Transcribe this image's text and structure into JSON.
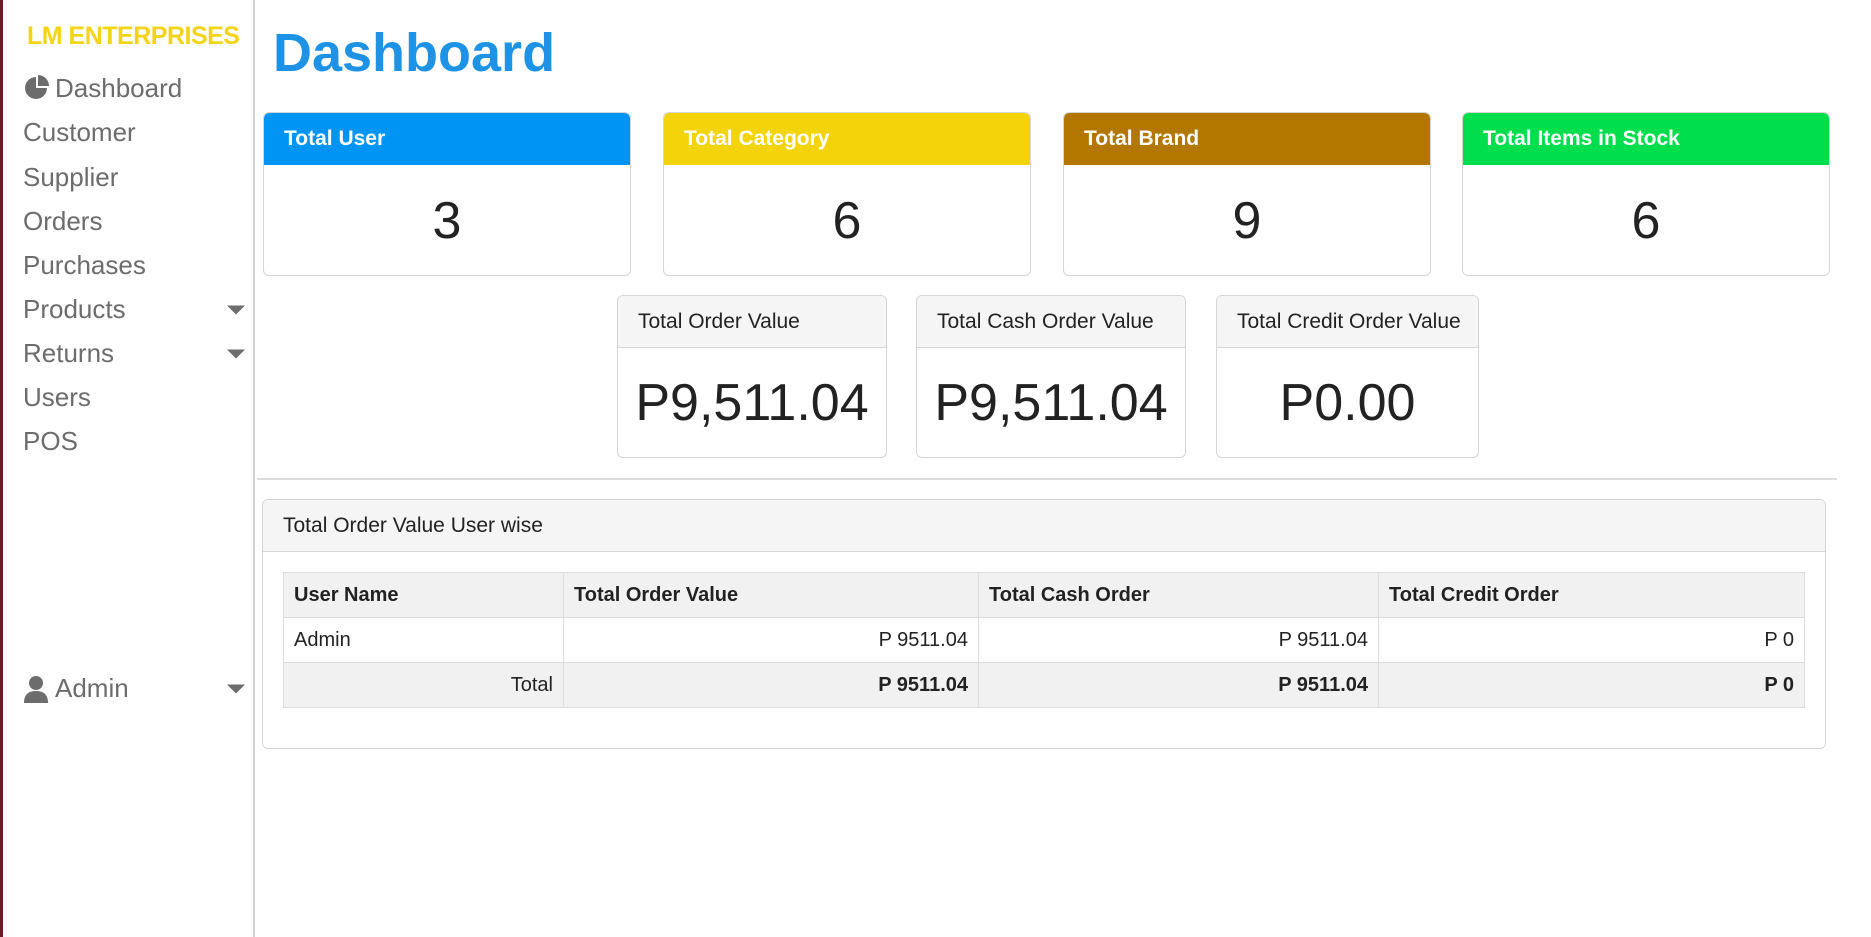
{
  "sidebar": {
    "brand": "LM ENTERPRISES",
    "items": [
      {
        "label": "Dashboard",
        "icon": "pie-chart-icon"
      },
      {
        "label": "Customer"
      },
      {
        "label": "Supplier"
      },
      {
        "label": "Orders"
      },
      {
        "label": "Purchases"
      },
      {
        "label": "Products",
        "has_dropdown": true
      },
      {
        "label": "Returns",
        "has_dropdown": true
      },
      {
        "label": "Users"
      },
      {
        "label": "POS"
      }
    ],
    "user": {
      "label": "Admin",
      "icon": "user-icon",
      "has_dropdown": true
    }
  },
  "page": {
    "title": "Dashboard"
  },
  "stats": [
    {
      "label": "Total User",
      "value": "3",
      "color": "#0095f5"
    },
    {
      "label": "Total Category",
      "value": "6",
      "color": "#f3d40b"
    },
    {
      "label": "Total Brand",
      "value": "9",
      "color": "#b37700"
    },
    {
      "label": "Total Items in Stock",
      "value": "6",
      "color": "#00dd4d"
    }
  ],
  "values": [
    {
      "label": "Total Order Value",
      "value": "P9,511.04"
    },
    {
      "label": "Total Cash Order Value",
      "value": "P9,511.04"
    },
    {
      "label": "Total Credit Order Value",
      "value": "P0.00"
    }
  ],
  "user_table": {
    "title": "Total Order Value User wise",
    "headers": [
      "User Name",
      "Total Order Value",
      "Total Cash Order",
      "Total Credit Order"
    ],
    "rows": [
      [
        "Admin",
        "P 9511.04",
        "P 9511.04",
        "P 0"
      ]
    ],
    "total": [
      "Total",
      "P 9511.04",
      "P 9511.04",
      "P 0"
    ]
  }
}
